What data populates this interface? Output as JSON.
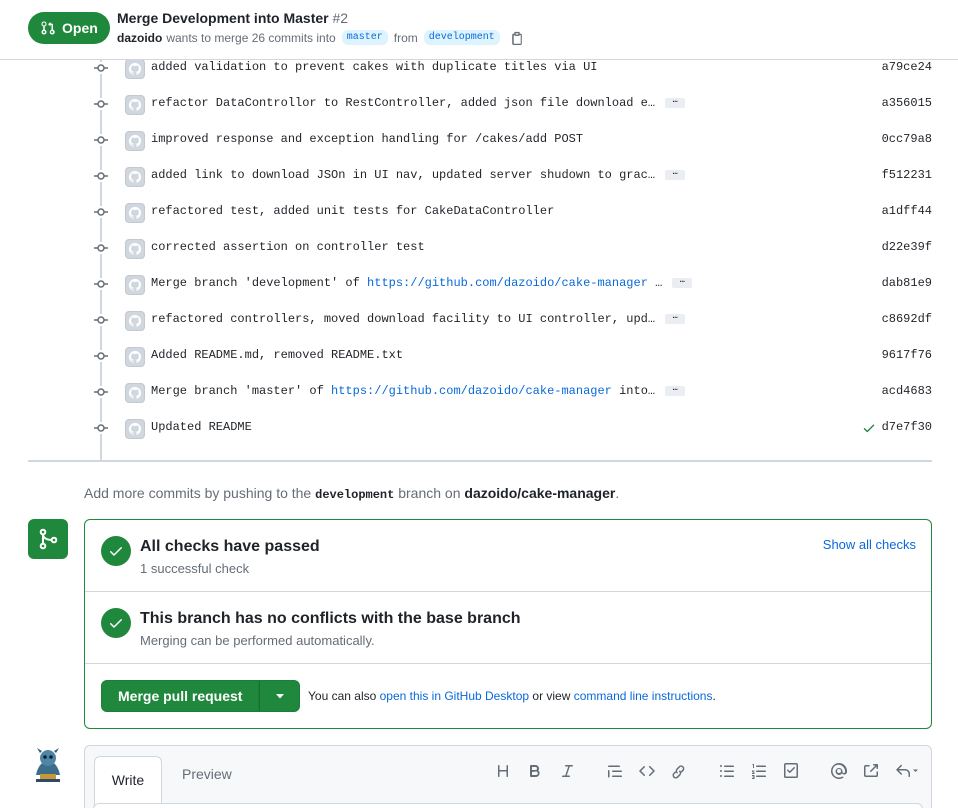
{
  "header": {
    "state": "Open",
    "title": "Merge Development into Master",
    "number": "#2",
    "author": "dazoido",
    "meta_text": "wants to merge 26 commits into",
    "base_branch": "master",
    "from_text": "from",
    "head_branch": "development"
  },
  "commits": [
    {
      "msg": "added validation to prevent cakes with duplicate titles via UI",
      "sha": "a79ce24"
    },
    {
      "msg": "refactor DataControllor to RestController, added json file download e…",
      "sha": "a356015"
    },
    {
      "msg": "improved response and exception handling for /cakes/add POST",
      "sha": "0cc79a8"
    },
    {
      "msg": "added link to download JSOn in UI nav, updated server shudown to grac…",
      "sha": "f512231"
    },
    {
      "msg": "refactored test, added unit tests for CakeDataController",
      "sha": "a1dff44"
    },
    {
      "msg": "corrected assertion on controller test",
      "sha": "d22e39f"
    },
    {
      "msg_prefix": "Merge branch 'development' of ",
      "link": "https://github.com/dazoido/cake-manager",
      "msg_suffix": " …",
      "sha": "dab81e9"
    },
    {
      "msg": "refactored controllers, moved download facility to UI controller, upd…",
      "sha": "c8692df"
    },
    {
      "msg": "Added README.md, removed README.txt",
      "sha": "9617f76"
    },
    {
      "msg_prefix": "Merge branch 'master' of ",
      "link": "https://github.com/dazoido/cake-manager",
      "msg_suffix": " into…",
      "sha": "acd4683"
    },
    {
      "msg": "Updated README",
      "sha": "d7e7f30"
    }
  ],
  "ellipsis": "…",
  "add_commits": {
    "prefix": "Add more commits by pushing to the",
    "branch": "development",
    "middle": "branch on",
    "repo": "dazoido/cake-manager",
    "suffix": "."
  },
  "merge_box": {
    "checks_title": "All checks have passed",
    "checks_sub": "1 successful check",
    "show_all": "Show all checks",
    "conflicts_title": "This branch has no conflicts with the base branch",
    "conflicts_sub": "Merging can be performed automatically.",
    "merge_button": "Merge pull request",
    "alt_prefix": "You can also",
    "alt_link1": "open this in GitHub Desktop",
    "alt_middle": "or view",
    "alt_link2": "command line instructions",
    "alt_suffix": "."
  },
  "composer": {
    "tab_write": "Write",
    "tab_preview": "Preview"
  },
  "colors": {
    "green": "#1f883d",
    "link": "#0969da"
  }
}
